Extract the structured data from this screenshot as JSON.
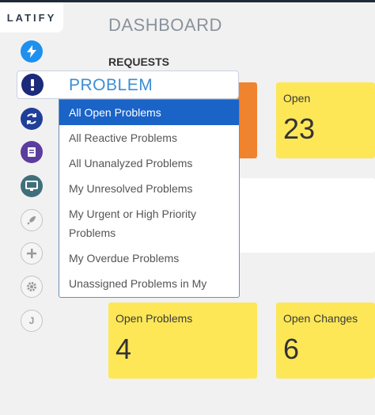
{
  "logo": {
    "text": "LATIFY"
  },
  "sidebar": {
    "icons": [
      "lightning-icon",
      "problem-icon",
      "refresh-icon",
      "book-icon",
      "monitor-icon",
      "rocket-icon",
      "plus-icon",
      "gear-icon",
      "user-initial-icon"
    ],
    "user_initial": "J"
  },
  "page": {
    "title": "DASHBOARD"
  },
  "section": {
    "requests_label": "REQUESTS"
  },
  "dropdown": {
    "selected": "PROBLEM",
    "options": [
      "All Open Problems",
      "All Reactive Problems",
      "All Unanalyzed Problems",
      "My Unresolved Problems",
      "My Urgent or High Priority Problems",
      "My Overdue Problems",
      "Unassigned Problems in My Group"
    ],
    "highlighted_index": 0
  },
  "tiles": {
    "open": {
      "title": "Open",
      "value": "23"
    },
    "open_problems": {
      "title": "Open Problems",
      "value": "4"
    },
    "open_changes": {
      "title": "Open Changes",
      "value": "6"
    }
  },
  "colors": {
    "accent_blue": "#1a63c7",
    "tile_yellow": "#fde757",
    "tile_orange": "#f0832e",
    "navy": "#1b2a7a"
  }
}
